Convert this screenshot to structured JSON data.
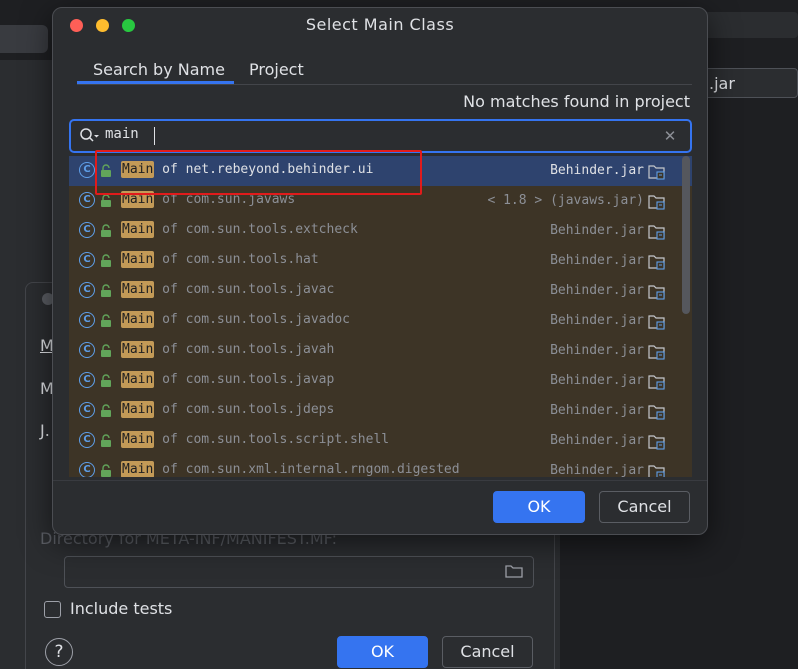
{
  "background": {
    "right_field_text": ".jar"
  },
  "artifact_dialog": {
    "label_partial_1": "M",
    "label_partial_2": "M",
    "label_partial_3": "J.",
    "directory_label": "Directory for META-INF/MANIFEST.MF:",
    "directory_value": "",
    "include_tests_label": "Include tests",
    "help_label": "?",
    "ok_label": "OK",
    "cancel_label": "Cancel"
  },
  "modal": {
    "title": "Select Main Class",
    "tabs": [
      {
        "label": "Search by Name",
        "active": true
      },
      {
        "label": "Project",
        "active": false
      }
    ],
    "status_text": "No matches found in project",
    "search": {
      "value": "main",
      "clear_icon": "close-icon"
    },
    "results": [
      {
        "name": "Main",
        "of": "of",
        "package": "net.rebeyond.behinder.ui",
        "location": "Behinder.jar",
        "selected": true
      },
      {
        "name": "Main",
        "of": "of",
        "package": "com.sun.javaws",
        "location": "< 1.8 > (javaws.jar)",
        "selected": false
      },
      {
        "name": "Main",
        "of": "of",
        "package": "com.sun.tools.extcheck",
        "location": "Behinder.jar",
        "selected": false
      },
      {
        "name": "Main",
        "of": "of",
        "package": "com.sun.tools.hat",
        "location": "Behinder.jar",
        "selected": false
      },
      {
        "name": "Main",
        "of": "of",
        "package": "com.sun.tools.javac",
        "location": "Behinder.jar",
        "selected": false
      },
      {
        "name": "Main",
        "of": "of",
        "package": "com.sun.tools.javadoc",
        "location": "Behinder.jar",
        "selected": false
      },
      {
        "name": "Main",
        "of": "of",
        "package": "com.sun.tools.javah",
        "location": "Behinder.jar",
        "selected": false
      },
      {
        "name": "Main",
        "of": "of",
        "package": "com.sun.tools.javap",
        "location": "Behinder.jar",
        "selected": false
      },
      {
        "name": "Main",
        "of": "of",
        "package": "com.sun.tools.jdeps",
        "location": "Behinder.jar",
        "selected": false
      },
      {
        "name": "Main",
        "of": "of",
        "package": "com.sun.tools.script.shell",
        "location": "Behinder.jar",
        "selected": false
      },
      {
        "name": "Main",
        "of": "of",
        "package": "com.sun.xml.internal.rngom.digested",
        "location": "Behinder.jar",
        "selected": false
      }
    ],
    "ok_label": "OK",
    "cancel_label": "Cancel"
  },
  "colors": {
    "accent": "#3574f0",
    "highlight_box": "#e11b1b",
    "list_bg": "#3d3426",
    "selected_row": "#2e436e",
    "match_highlight": "#c39a57"
  }
}
